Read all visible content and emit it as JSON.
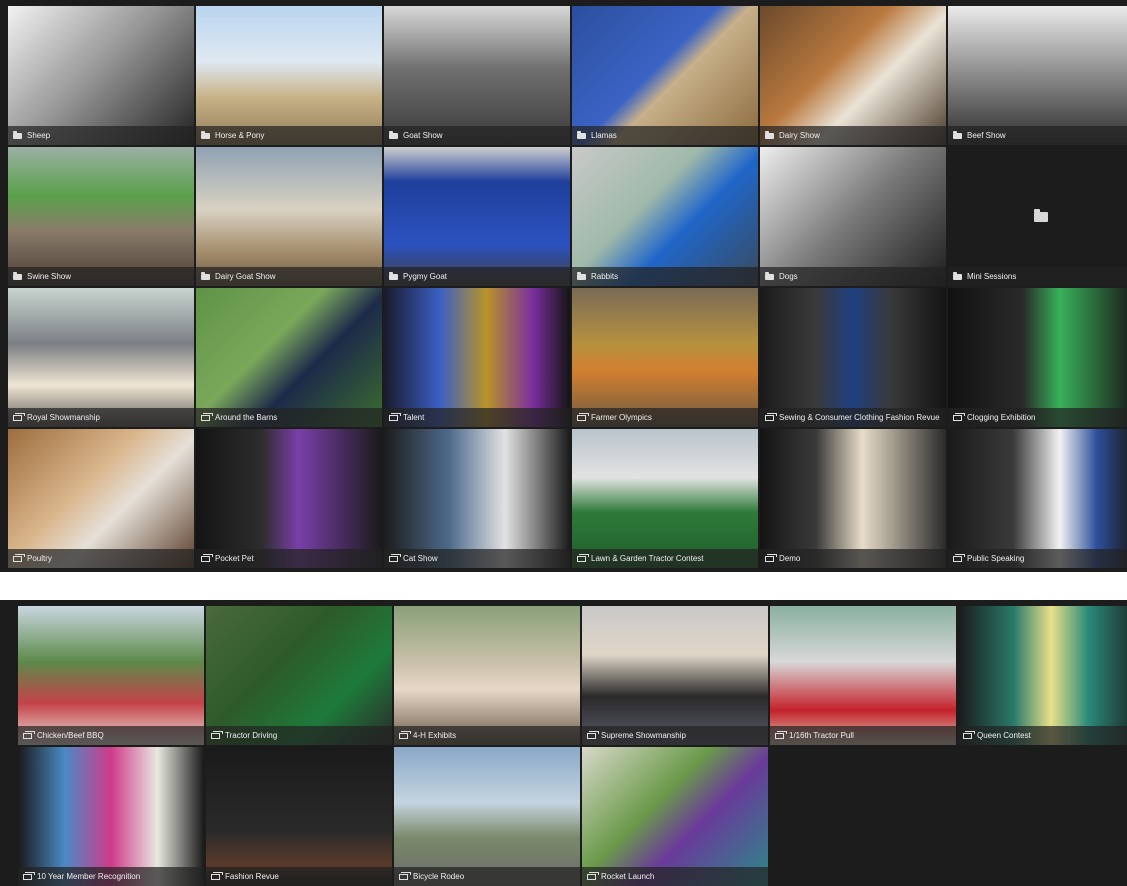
{
  "gallery_top": {
    "tiles": [
      {
        "label": "Sheep",
        "icon": "folder-icon",
        "bg": "linear-gradient(135deg,#f2f2f2 0%,#9a9a9a 45%,#222 100%)"
      },
      {
        "label": "Horse & Pony",
        "icon": "folder-icon",
        "bg": "linear-gradient(180deg,#b9d4ee 0%,#dfe9f2 40%,#c9b489 65%,#8f7a55 100%)"
      },
      {
        "label": "Goat Show",
        "icon": "folder-icon",
        "bg": "linear-gradient(180deg,#d8d8d8 0%,#707070 45%,#3a3a3a 100%)"
      },
      {
        "label": "Llamas",
        "icon": "folder-icon",
        "bg": "linear-gradient(135deg,#2b4f9e 0%,#3b63c4 45%,#c7b08a 55%,#8b6a3d 100%)"
      },
      {
        "label": "Dairy Show",
        "icon": "folder-icon",
        "bg": "linear-gradient(135deg,#6b4a2c 0%,#b9793f 40%,#e9e3d6 60%,#4a3a2a 100%)"
      },
      {
        "label": "Beef Show",
        "icon": "folder-icon",
        "bg": "linear-gradient(180deg,#eaeaea 0%,#8a8a8a 50%,#2e2e2e 100%)"
      },
      {
        "label": "Swine Show",
        "icon": "folder-icon",
        "bg": "linear-gradient(180deg,#9bb0a4 0%,#5aa14a 35%,#8a7b6a 60%,#4a3d33 100%)"
      },
      {
        "label": "Dairy Goat Show",
        "icon": "folder-icon",
        "bg": "linear-gradient(180deg,#8fa2b3 0%,#d9d2c2 45%,#a58e6d 75%,#6b5a45 100%)"
      },
      {
        "label": "Pygmy Goat",
        "icon": "folder-icon",
        "bg": "linear-gradient(180deg,#cfcfcf 0%,#1f3f9c 25%,#2c52c0 70%,#3d3d3d 100%)"
      },
      {
        "label": "Rabbits",
        "icon": "folder-icon",
        "bg": "linear-gradient(135deg,#c9c9c9 0%,#9fb9a9 40%,#2066c8 60%,#3b4a5c 100%)"
      },
      {
        "label": "Dogs",
        "icon": "folder-icon",
        "bg": "linear-gradient(135deg,#eeeeee 0%,#7a7a7a 50%,#1c1c1c 100%)"
      },
      {
        "label": "Mini Sessions",
        "icon": "folder-icon",
        "bg": "",
        "empty": true
      },
      {
        "label": "Royal Showmanship",
        "icon": "gallery-icon",
        "bg": "linear-gradient(180deg,#c8d4cf 0%,#7b7f84 40%,#efe5d3 70%,#5e5a57 100%)"
      },
      {
        "label": "Around the Barns",
        "icon": "gallery-icon",
        "bg": "linear-gradient(135deg,#5f9347 0%,#7aa85a 40%,#1d2a4a 60%,#3b6e2e 100%)"
      },
      {
        "label": "Talent",
        "icon": "gallery-icon",
        "bg": "linear-gradient(90deg,#1a1a2a 0%,#3b5fc4 30%,#b8942a 55%,#7a2e9e 80%,#141414 100%)"
      },
      {
        "label": "Farmer Olympics",
        "icon": "gallery-icon",
        "bg": "linear-gradient(180deg,#7a6a55 0%,#b5913f 40%,#d27f2e 60%,#6b5a45 100%)"
      },
      {
        "label": "Sewing & Consumer Clothing Fashion Revue",
        "icon": "gallery-icon",
        "bg": "linear-gradient(90deg,#1a1a1a 0%,#3a3a3a 30%,#1e3f80 50%,#3a3a3a 70%,#141414 100%)"
      },
      {
        "label": "Clogging Exhibition",
        "icon": "gallery-icon",
        "bg": "linear-gradient(90deg,#111 0%,#2a2a2a 40%,#38b05a 60%,#1a1a1a 100%)"
      },
      {
        "label": "Poultry",
        "icon": "gallery-icon",
        "bg": "linear-gradient(135deg,#9c6e3e 0%,#d9b48a 40%,#e5e0d8 60%,#5a3c2a 100%)"
      },
      {
        "label": "Pocket Pet",
        "icon": "gallery-icon",
        "bg": "linear-gradient(90deg,#141414 0%,#2c2c2c 35%,#7a3fa8 55%,#1a1a1a 100%)"
      },
      {
        "label": "Cat Show",
        "icon": "gallery-icon",
        "bg": "linear-gradient(90deg,#1c1c1c 0%,#4d6a8c 35%,#e2e2e2 65%,#1a1a1a 100%)"
      },
      {
        "label": "Lawn & Garden Tractor Contest",
        "icon": "gallery-icon",
        "bg": "linear-gradient(180deg,#b9c4cc 0%,#e2e2e2 35%,#2e7a3a 60%,#1f5e2a 100%)"
      },
      {
        "label": "Demo",
        "icon": "gallery-icon",
        "bg": "linear-gradient(90deg,#141414 0%,#3a3a3a 30%,#e8dcc8 55%,#2a2a2a 100%)"
      },
      {
        "label": "Public Speaking",
        "icon": "gallery-icon",
        "bg": "linear-gradient(90deg,#1a1a1a 0%,#3a3a3a 35%,#f2f2f2 60%,#2d4f9a 80%,#1a1a1a 100%)"
      }
    ]
  },
  "gallery_bottom": {
    "tiles": [
      {
        "label": "Chicken/Beef BBQ",
        "icon": "gallery-icon",
        "bg": "linear-gradient(180deg,#c9d6e0 0%,#5d8a4a 40%,#c4434a 70%,#e8e0d8 100%)"
      },
      {
        "label": "Tractor Driving",
        "icon": "gallery-icon",
        "bg": "linear-gradient(135deg,#4a6a3a 0%,#2e5a2a 40%,#1e7a3a 70%,#2a2a2a 100%)"
      },
      {
        "label": "4-H Exhibits",
        "icon": "gallery-icon",
        "bg": "linear-gradient(180deg,#8aa07a 0%,#c8c0a8 40%,#e8d8c8 60%,#6a5a4a 100%)"
      },
      {
        "label": "Supreme Showmanship",
        "icon": "gallery-icon",
        "bg": "linear-gradient(180deg,#c8c8c8 0%,#e0d6c8 35%,#2a2a2a 65%,#5a5a6a 100%)"
      },
      {
        "label": "1/16th Tractor Pull",
        "icon": "gallery-icon",
        "bg": "linear-gradient(180deg,#8ab0a0 0%,#d8d8d8 40%,#c4212a 75%,#d8c8b8 100%)"
      },
      {
        "label": "Queen Contest",
        "icon": "gallery-icon",
        "bg": "linear-gradient(90deg,#1a1a1a 0%,#2a7a6a 30%,#e8e08a 50%,#2a8a7a 70%,#1a1a1a 100%)"
      },
      {
        "label": "10 Year Member Recognition",
        "icon": "gallery-icon",
        "bg": "linear-gradient(90deg,#1a1a1a 0%,#4a8ac4 25%,#d03a8a 50%,#e8e8e0 75%,#1a1a1a 100%)"
      },
      {
        "label": "Fashion Revue",
        "icon": "gallery-icon",
        "bg": "linear-gradient(180deg,#1a1a1a 0%,#2a2a2a 60%,#5a3a2a 85%,#1a1a1a 100%)"
      },
      {
        "label": "Bicycle Rodeo",
        "icon": "gallery-icon",
        "bg": "linear-gradient(180deg,#8aa8c8 0%,#c4d4e0 40%,#7a8a6a 65%,#6a6a6a 100%)"
      },
      {
        "label": "Rocket Launch",
        "icon": "gallery-icon",
        "bg": "linear-gradient(135deg,#d8d8c8 0%,#6a9a4a 40%,#6a3a9a 60%,#2a8a8a 100%)"
      }
    ]
  }
}
